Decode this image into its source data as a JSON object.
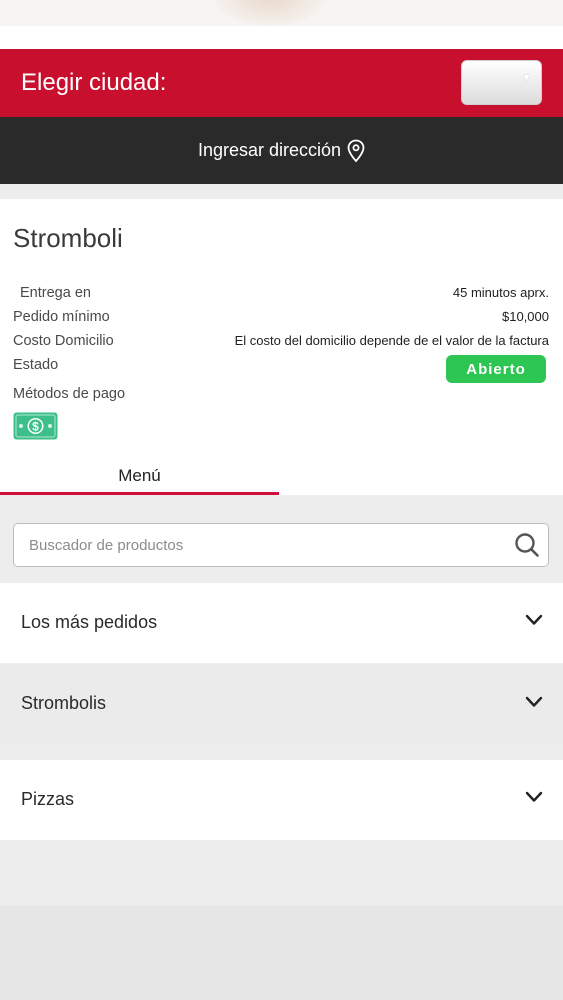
{
  "header": {
    "city_label": "Elegir ciudad:",
    "city_select_value": ""
  },
  "address_bar": {
    "label": "Ingresar dirección",
    "icon": "location-pin-icon"
  },
  "store": {
    "name": "Stromboli",
    "details": [
      {
        "label": "Entrega en",
        "value": "45 minutos aprx."
      },
      {
        "label": "Pedido mínimo",
        "value": "$10,000"
      },
      {
        "label": "Costo Domicilio",
        "value": "El costo del domicilio depende de el valor de la factura"
      },
      {
        "label": "Estado",
        "value": "Abierto"
      }
    ],
    "payment_label": "Métodos de pago",
    "payment_icon": "cash-icon"
  },
  "tabs": [
    {
      "label": "Menú",
      "active": true
    }
  ],
  "search": {
    "placeholder": "Buscador de productos",
    "icon": "search-icon"
  },
  "categories": [
    {
      "label": "Los más pedidos"
    },
    {
      "label": "Strombolis"
    },
    {
      "label": "Pizzas"
    }
  ],
  "colors": {
    "brand_red": "#c8102e",
    "dark_bar": "#2a2a2b",
    "status_green": "#2dc653",
    "tab_underline": "#d0103a",
    "cash_green": "#3dbf8a"
  }
}
